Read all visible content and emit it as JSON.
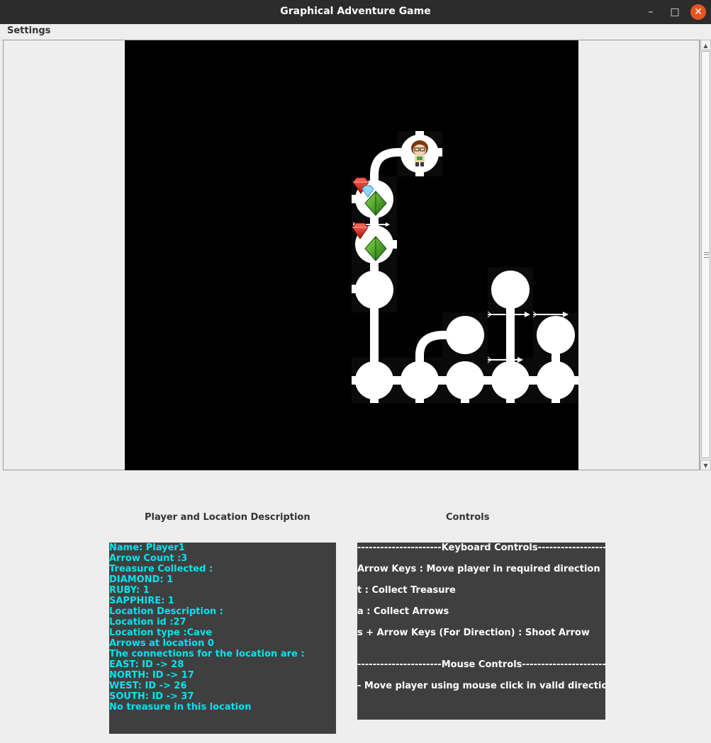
{
  "window": {
    "title": "Graphical Adventure Game",
    "minimize_glyph": "–",
    "maximize_glyph": "□",
    "close_glyph": "✕"
  },
  "menu": {
    "items": [
      {
        "label": "Settings"
      }
    ]
  },
  "map": {
    "background": "#000000",
    "tile_color": "#ffffff",
    "elements": {
      "player": "player-sprite-icon",
      "treasures": [
        "ruby-icon",
        "diamond-icon",
        "sapphire-icon"
      ],
      "arrows": "arrow-icon"
    }
  },
  "panels": {
    "description_title": "Player and Location Description",
    "controls_title": "Controls"
  },
  "player_info": {
    "lines": [
      "Name: Player1",
      "Arrow Count :3",
      "Treasure Collected :",
      "DIAMOND: 1",
      "RUBY: 1",
      "SAPPHIRE: 1",
      "Location Description :",
      "Location id :27",
      "Location type :Cave",
      "Arrows at location 0",
      "The connections for the location are :",
      "EAST: ID -> 28",
      "NORTH: ID -> 17",
      "WEST: ID -> 26",
      "SOUTH: ID -> 37",
      "No treasure in this location"
    ],
    "text_color": "#00e5ee",
    "background": "#3f3f3f"
  },
  "controls": {
    "keyboard_header": "----------------------Keyboard Controls--------------------",
    "keyboard": [
      "Arrow Keys : Move player in required direction",
      " t : Collect Treasure",
      " a : Collect Arrows",
      " s + Arrow Keys (For Direction) : Shoot Arrow"
    ],
    "mouse_header": "----------------------Mouse Controls------------------------",
    "mouse": [
      "- Move player using mouse click in valid direction"
    ]
  }
}
